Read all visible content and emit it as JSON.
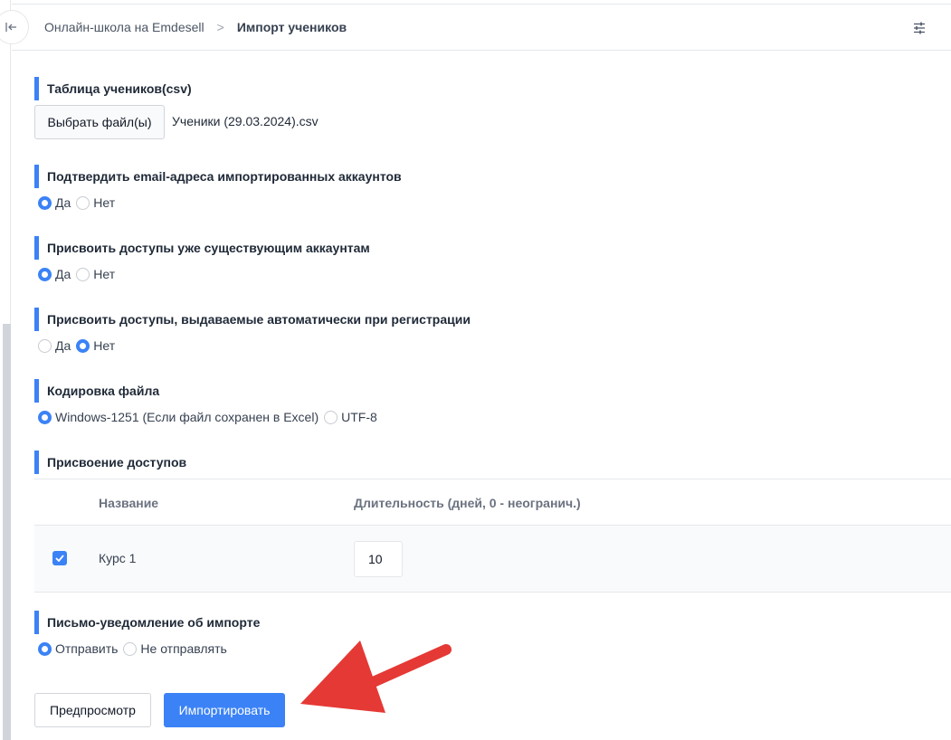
{
  "breadcrumb": {
    "school": "Онлайн-школа на Emdesell",
    "separator": ">",
    "current": "Импорт учеников"
  },
  "sections": {
    "csv": {
      "title": "Таблица учеников(csv)",
      "button_label": "Выбрать файл(ы)",
      "file_name": "Ученики (29.03.2024).csv"
    },
    "confirm_email": {
      "title": "Подтвердить email-адреса импортированных аккаунтов",
      "options": [
        {
          "label": "Да",
          "selected": true
        },
        {
          "label": "Нет",
          "selected": false
        }
      ]
    },
    "existing_accounts": {
      "title": "Присвоить доступы уже существующим аккаунтам",
      "options": [
        {
          "label": "Да",
          "selected": true
        },
        {
          "label": "Нет",
          "selected": false
        }
      ]
    },
    "auto_access": {
      "title": "Присвоить доступы, выдаваемые автоматически при регистрации",
      "options": [
        {
          "label": "Да",
          "selected": false
        },
        {
          "label": "Нет",
          "selected": true
        }
      ]
    },
    "encoding": {
      "title": "Кодировка файла",
      "options": [
        {
          "label": "Windows-1251 (Если файл сохранен в Excel)",
          "selected": true
        },
        {
          "label": "UTF-8",
          "selected": false
        }
      ]
    },
    "access": {
      "title": "Присвоение доступов",
      "columns": {
        "name": "Название",
        "duration": "Длительность (дней, 0 - неогранич.)"
      },
      "rows": [
        {
          "checked": true,
          "name": "Курс 1",
          "duration": "10"
        }
      ]
    },
    "notify": {
      "title": "Письмо-уведомление об импорте",
      "options": [
        {
          "label": "Отправить",
          "selected": true
        },
        {
          "label": "Не отправлять",
          "selected": false
        }
      ]
    }
  },
  "actions": {
    "preview_label": "Предпросмотр",
    "import_label": "Импортировать"
  },
  "colors": {
    "accent": "#3b82f6",
    "arrow": "#e53935"
  }
}
